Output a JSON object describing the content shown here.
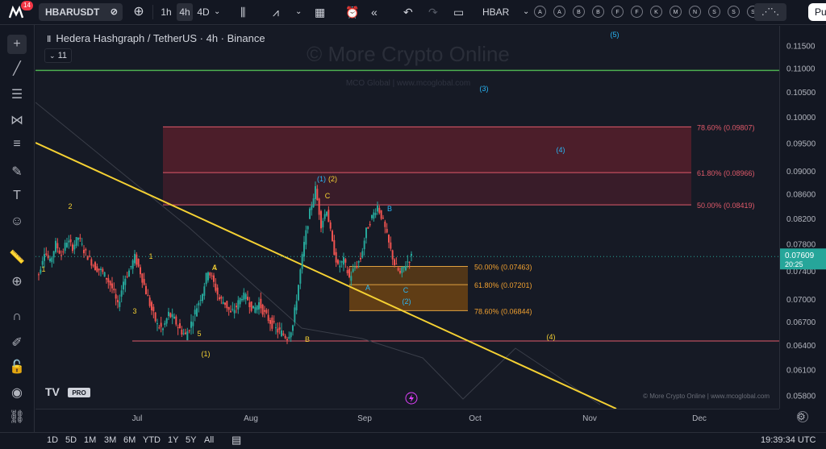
{
  "app": {
    "logo_text": "M",
    "notification_count": "14"
  },
  "toolbar": {
    "symbol": "HBARUSDT",
    "timeframes": [
      "1h",
      "4h",
      "4D"
    ],
    "active_timeframe": "4h",
    "compare_symbol": "HBAR",
    "letter_buttons": [
      "A",
      "A",
      "B",
      "B",
      "F",
      "F",
      "K",
      "M",
      "N",
      "S",
      "S",
      "S"
    ],
    "right_button": "Pu"
  },
  "legend": {
    "title": "Hedera Hashgraph / TetherUS · 4h · Binance",
    "collapse_count": "11"
  },
  "watermark": {
    "main": "© More Crypto Online",
    "sub": "MCO Global  |  www.mcoglobal.com",
    "footer": "© More Crypto Online  |  www.mcoglobal.com"
  },
  "price_axis": {
    "ticks": [
      "0.11500",
      "0.11000",
      "0.10500",
      "0.10000",
      "0.09500",
      "0.09000",
      "0.08600",
      "0.08200",
      "0.07800",
      "0.07400",
      "0.07000",
      "0.06700",
      "0.06400",
      "0.06100",
      "0.05800"
    ],
    "current_price": "0.07609",
    "countdown": "20:25"
  },
  "time_axis": {
    "ticks": [
      "Jul",
      "Aug",
      "Sep",
      "Oct",
      "Nov",
      "Dec"
    ]
  },
  "bottom": {
    "ranges": [
      "1D",
      "5D",
      "1M",
      "3M",
      "6M",
      "YTD",
      "1Y",
      "5Y",
      "All"
    ],
    "clock": "19:39:34 UTC"
  },
  "logo_badge": {
    "text": "TV",
    "pro": "PRO"
  },
  "chart_data": {
    "type": "line",
    "title": "Hedera Hashgraph / TetherUS · 4h · Binance",
    "y_scale": "log",
    "ylim": [
      0.0565,
      0.1195
    ],
    "x_ticks": [
      "Jul",
      "Aug",
      "Sep",
      "Oct",
      "Nov",
      "Dec"
    ],
    "series": [
      {
        "values": [
          0.0735,
          0.077,
          0.0752,
          0.078,
          0.0763,
          0.0785,
          0.0775,
          0.079,
          0.077,
          0.0757,
          0.0745,
          0.074,
          0.073,
          0.0715,
          0.069,
          0.0725,
          0.074,
          0.076,
          0.0738,
          0.071,
          0.0685,
          0.0665,
          0.066,
          0.068,
          0.0672,
          0.066,
          0.0652,
          0.0668,
          0.069,
          0.071,
          0.0742,
          0.0722,
          0.07,
          0.0695,
          0.068,
          0.069,
          0.0705,
          0.07,
          0.0685,
          0.0695,
          0.068,
          0.067,
          0.066,
          0.0655,
          0.065,
          0.0665,
          0.072,
          0.078,
          0.083,
          0.0869,
          0.081,
          0.0835,
          0.078,
          0.0745,
          0.0755,
          0.073,
          0.0745,
          0.0758,
          0.08,
          0.0822,
          0.084,
          0.0815,
          0.078,
          0.075,
          0.0735,
          0.075,
          0.0761
        ]
      }
    ],
    "fib_levels_upper": [
      {
        "label": "78.60% (0.09807)",
        "value": 0.09807
      },
      {
        "label": "61.80% (0.08966)",
        "value": 0.08966
      },
      {
        "label": "50.00% (0.08419)",
        "value": 0.08419
      }
    ],
    "fib_levels_lower": [
      {
        "label": "50.00% (0.07463)",
        "value": 0.07463
      },
      {
        "label": "61.80% (0.07201)",
        "value": 0.07201
      },
      {
        "label": "78.60% (0.06844)",
        "value": 0.06844
      }
    ],
    "horizontal_lines": [
      {
        "value": 0.1095,
        "color": "#4caf50"
      },
      {
        "value": 0.0645,
        "color": "#e05a6a"
      }
    ],
    "wave_labels": [
      "1",
      "2",
      "1",
      "3",
      "4",
      "5",
      "(1)",
      "A",
      "B",
      "C",
      "(1)(2)",
      "A",
      "B",
      "C",
      "(2)",
      "(3)",
      "(4)",
      "(4)",
      "(5)"
    ],
    "colors": {
      "up": "#26a69a",
      "down": "#ef5350",
      "trendline": "#f5d133",
      "upper_zone": "#7a2330",
      "lower_zone": "#7a4a10",
      "price_tag": "#26a69a"
    }
  }
}
